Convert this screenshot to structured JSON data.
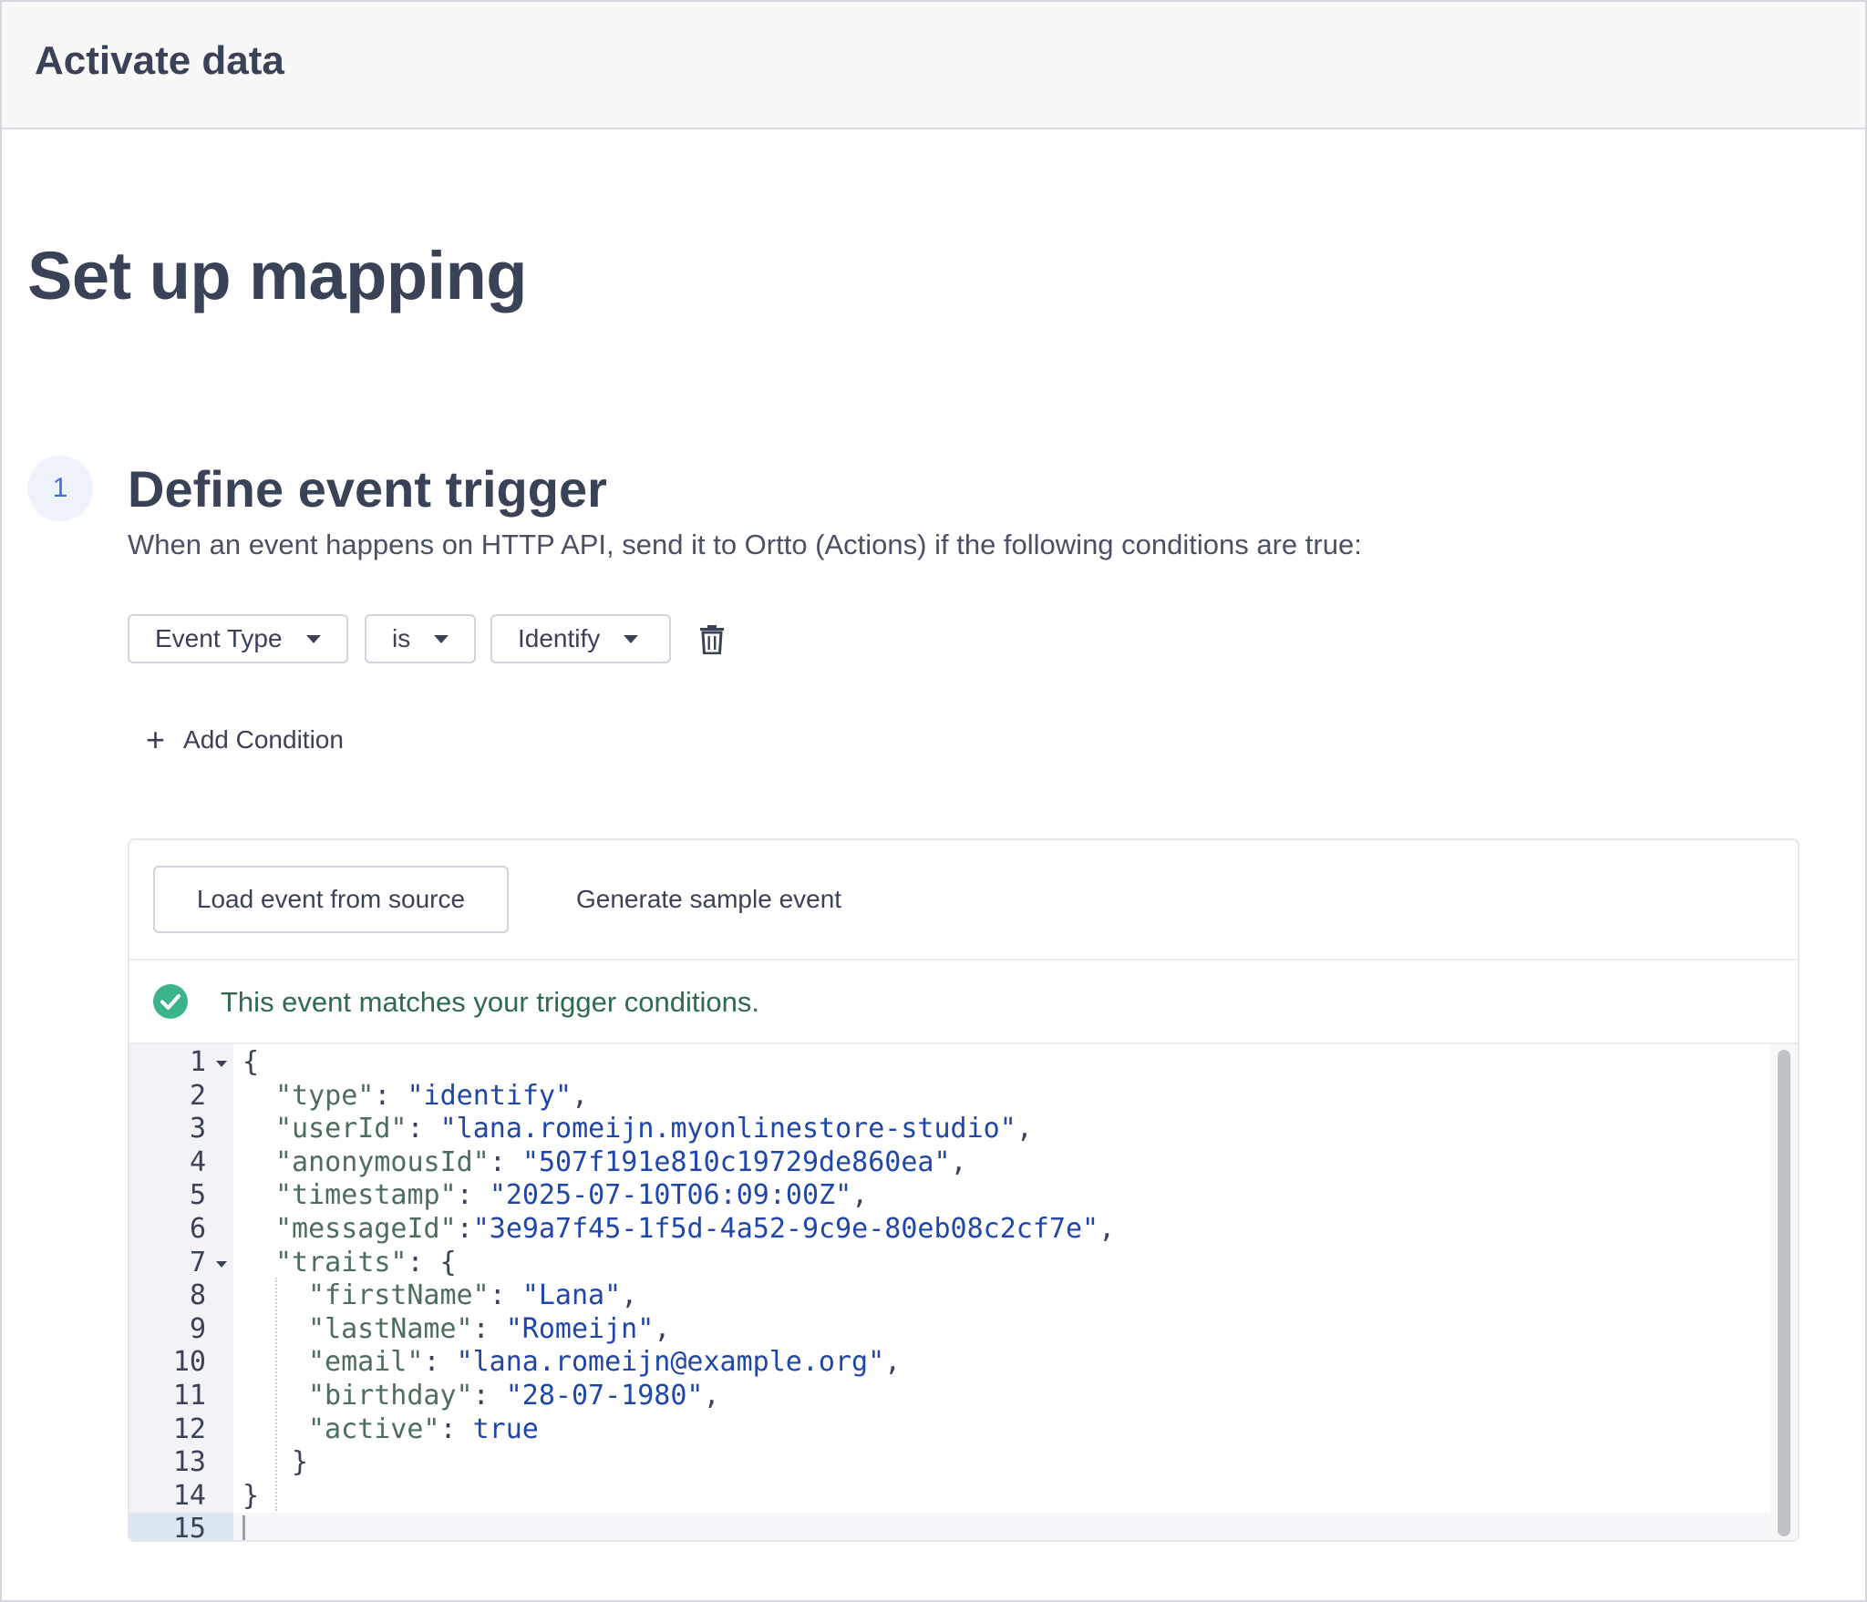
{
  "header": {
    "title": "Activate data"
  },
  "page": {
    "title": "Set up mapping"
  },
  "step": {
    "number": "1",
    "title": "Define event trigger",
    "description": "When an event happens on HTTP API, send it to Ortto (Actions) if the following conditions are true:"
  },
  "condition": {
    "field": "Event Type",
    "operator": "is",
    "value": "Identify"
  },
  "add_condition_label": "Add Condition",
  "panel": {
    "load_button": "Load event from source",
    "generate_button": "Generate sample event",
    "match_message": "This event matches your trigger conditions."
  },
  "colors": {
    "accent": "#3d6fd6",
    "success": "#3cb489",
    "success_text": "#2e6b4c",
    "json_key": "#4e6e5c",
    "json_string": "#1f46a8"
  },
  "editor": {
    "lines": [
      {
        "n": "1",
        "fold": true,
        "text": "{"
      },
      {
        "n": "2",
        "key": "\"type\"",
        "sep": ": ",
        "val": "\"identify\"",
        "end": ",",
        "indent": 1
      },
      {
        "n": "3",
        "key": "\"userId\"",
        "sep": ": ",
        "val": "\"lana.romeijn.myonlinestore-studio\"",
        "end": ",",
        "indent": 1
      },
      {
        "n": "4",
        "key": "\"anonymousId\"",
        "sep": ": ",
        "val": "\"507f191e810c19729de860ea\"",
        "end": ",",
        "indent": 1
      },
      {
        "n": "5",
        "key": "\"timestamp\"",
        "sep": ": ",
        "val": "\"2025-07-10T06:09:00Z\"",
        "end": ",",
        "indent": 1
      },
      {
        "n": "6",
        "key": "\"messageId\"",
        "sep": ":",
        "val": "\"3e9a7f45-1f5d-4a52-9c9e-80eb08c2cf7e\"",
        "end": ",",
        "indent": 1
      },
      {
        "n": "7",
        "fold": true,
        "key": "\"traits\"",
        "sep": ": ",
        "val": "",
        "end": "{",
        "indent": 1
      },
      {
        "n": "8",
        "key": "\"firstName\"",
        "sep": ": ",
        "val": "\"Lana\"",
        "end": ",",
        "indent": 2
      },
      {
        "n": "9",
        "key": "\"lastName\"",
        "sep": ": ",
        "val": "\"Romeijn\"",
        "end": ",",
        "indent": 2
      },
      {
        "n": "10",
        "key": "\"email\"",
        "sep": ": ",
        "val": "\"lana.romeijn@example.org\"",
        "end": ",",
        "indent": 2
      },
      {
        "n": "11",
        "key": "\"birthday\"",
        "sep": ": ",
        "val": "\"28-07-1980\"",
        "end": ",",
        "indent": 2
      },
      {
        "n": "12",
        "key": "\"active\"",
        "sep": ": ",
        "val": "true",
        "end": "",
        "indent": 2
      },
      {
        "n": "13",
        "text": "}",
        "indent": 1.5
      },
      {
        "n": "14",
        "text": "}"
      },
      {
        "n": "15",
        "text": "",
        "active": true
      }
    ]
  }
}
